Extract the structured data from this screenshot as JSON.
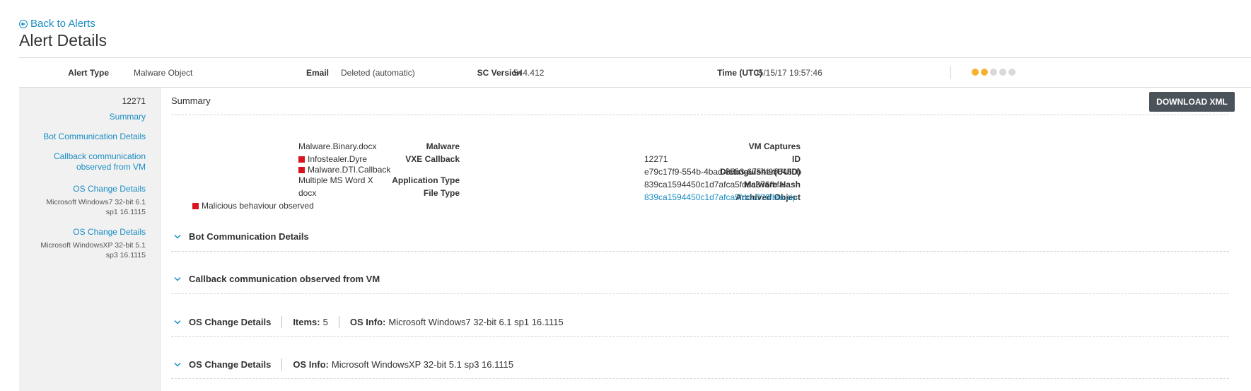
{
  "header": {
    "back_label": "Back to Alerts",
    "title": "Alert Details"
  },
  "info_bar": {
    "alert_type_label": "Alert Type",
    "alert_type_value": "Malware Object",
    "email_label": "Email",
    "email_value": "Deleted (automatic)",
    "sc_version_label": "SC Version",
    "sc_version_value": "544.412",
    "time_label": "Time (UTC)",
    "time_value": "05/15/17 19:57:46",
    "severity_level": 2,
    "severity_max": 5,
    "severity_color_active": "#f5b32f",
    "severity_color_inactive": "#d9d9d9"
  },
  "sidebar": {
    "id": "12271",
    "links": [
      "Summary",
      "Bot Communication Details",
      "Callback communication observed from VM",
      "OS Change Details",
      "Microsoft Windows7 32-bit 6.1 sp1 16.1115",
      "OS Change Details",
      "Microsoft WindowsXP 32-bit 5.1 sp3 16.1115"
    ]
  },
  "summary": {
    "title": "Summary",
    "download_label": "DOWNLOAD XML",
    "left": {
      "malware_label": "Malware",
      "malware_value": "Malware.Binary.docx",
      "vxe_callback_label": "VXE Callback",
      "vxe_callbacks": [
        "Infostealer.Dyre",
        "Malware.DTI.Callback"
      ],
      "app_type_label": "Application Type",
      "app_type_value": "Multiple MS Word X",
      "file_type_label": "File Type",
      "file_type_value": "docx",
      "malicious_note": "Malicious behaviour observed"
    },
    "right": {
      "vm_captures_label": "VM Captures",
      "id_label": "ID",
      "id_value": "12271",
      "uuid_label": "Distinguisher(UUID)",
      "uuid_value": "e79c17f9-554b-4bad-85b3-6754f9b6460b",
      "hash_label": "Malware Hash",
      "hash_value": "839ca1594450c1d7afca5fddc376fbfa",
      "archived_label": "Archived Object",
      "archived_value": "839ca1594450c1d7afca5fddc376fbfa.zip"
    }
  },
  "sections": {
    "bot_title": "Bot Communication Details",
    "callback_title": "Callback communication observed from VM",
    "os1_title": "OS Change Details",
    "os1_items_label": "Items:",
    "os1_items_value": "5",
    "os1_info_label": "OS Info:",
    "os1_info_value": "Microsoft Windows7 32-bit 6.1 sp1 16.1115",
    "os2_title": "OS Change Details",
    "os2_info_label": "OS Info:",
    "os2_info_value": "Microsoft WindowsXP 32-bit 5.1 sp3 16.1115"
  },
  "colors": {
    "link": "#1a8cc4",
    "alert_red": "#d9141f",
    "button_bg": "#4a525a"
  }
}
